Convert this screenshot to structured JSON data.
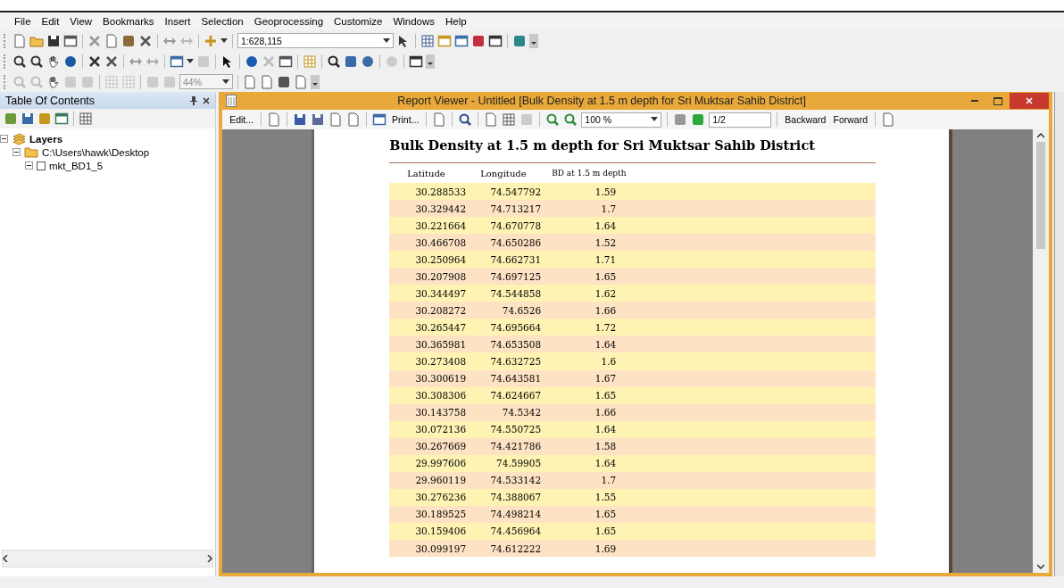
{
  "menu": [
    "File",
    "Edit",
    "View",
    "Bookmarks",
    "Insert",
    "Selection",
    "Geoprocessing",
    "Customize",
    "Windows",
    "Help"
  ],
  "toolbars": {
    "scale": "1:628,115",
    "zoom": "44%"
  },
  "toc": {
    "title": "Table Of Contents",
    "tree": [
      {
        "label": "Layers",
        "kind": "dataframe",
        "expanded": true,
        "children": [
          {
            "label": "C:\\Users\\hawk\\Desktop",
            "kind": "folder",
            "expanded": true,
            "children": [
              {
                "label": "mkt_BD1_5",
                "kind": "layer",
                "expanded": true,
                "checked": false
              }
            ]
          }
        ]
      }
    ]
  },
  "report_viewer": {
    "title": "Report Viewer - Untitled [Bulk Density at 1.5 m depth for Sri Muktsar Sahib District]",
    "toolbar": {
      "edit": "Edit...",
      "print": "Print...",
      "zoom": "100 %",
      "page": "1/2",
      "backward": "Backward",
      "forward": "Forward"
    },
    "report": {
      "title": "Bulk Density at 1.5 m depth for Sri Muktsar Sahib District",
      "columns": [
        "Latitude",
        "Longitude",
        "BD at 1.5 m depth"
      ],
      "rows": [
        [
          "30.288533",
          "74.547792",
          "1.59"
        ],
        [
          "30.329442",
          "74.713217",
          "1.7"
        ],
        [
          "30.221664",
          "74.670778",
          "1.64"
        ],
        [
          "30.466708",
          "74.650286",
          "1.52"
        ],
        [
          "30.250964",
          "74.662731",
          "1.71"
        ],
        [
          "30.207908",
          "74.697125",
          "1.65"
        ],
        [
          "30.344497",
          "74.544858",
          "1.62"
        ],
        [
          "30.208272",
          "74.6526",
          "1.66"
        ],
        [
          "30.265447",
          "74.695664",
          "1.72"
        ],
        [
          "30.365981",
          "74.653508",
          "1.64"
        ],
        [
          "30.273408",
          "74.632725",
          "1.6"
        ],
        [
          "30.300619",
          "74.643581",
          "1.67"
        ],
        [
          "30.308306",
          "74.624667",
          "1.65"
        ],
        [
          "30.143758",
          "74.5342",
          "1.66"
        ],
        [
          "30.072136",
          "74.550725",
          "1.64"
        ],
        [
          "30.267669",
          "74.421786",
          "1.58"
        ],
        [
          "29.997606",
          "74.59905",
          "1.64"
        ],
        [
          "29.960119",
          "74.533142",
          "1.7"
        ],
        [
          "30.276236",
          "74.388067",
          "1.55"
        ],
        [
          "30.189525",
          "74.498214",
          "1.65"
        ],
        [
          "30.159406",
          "74.456964",
          "1.65"
        ],
        [
          "30.099197",
          "74.612222",
          "1.69"
        ]
      ]
    }
  }
}
